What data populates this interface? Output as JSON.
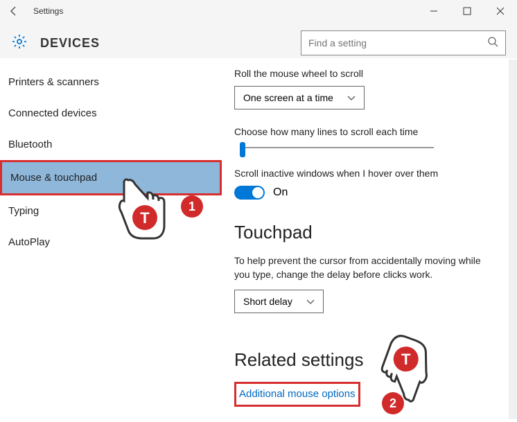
{
  "window": {
    "title": "Settings"
  },
  "header": {
    "page_title": "DEVICES",
    "search_placeholder": "Find a setting"
  },
  "sidebar": {
    "items": [
      {
        "label": "Printers & scanners"
      },
      {
        "label": "Connected devices"
      },
      {
        "label": "Bluetooth"
      },
      {
        "label": "Mouse & touchpad"
      },
      {
        "label": "Typing"
      },
      {
        "label": "AutoPlay"
      }
    ]
  },
  "content": {
    "scroll_label": "Roll the mouse wheel to scroll",
    "scroll_dropdown_value": "One screen at a time",
    "lines_label": "Choose how many lines to scroll each time",
    "inactive_label": "Scroll inactive windows when I hover over them",
    "toggle_state": "On",
    "touchpad_heading": "Touchpad",
    "touchpad_help": "To help prevent the cursor from accidentally moving while you type, change the delay before clicks work.",
    "delay_dropdown_value": "Short delay",
    "related_heading": "Related settings",
    "additional_link": "Additional mouse options"
  },
  "annotations": {
    "badge1": "1",
    "badge2": "2"
  }
}
